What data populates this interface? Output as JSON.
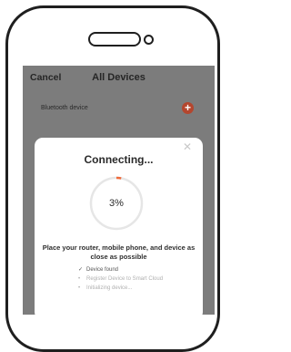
{
  "nav": {
    "cancel_label": "Cancel",
    "title": "All Devices"
  },
  "device": {
    "label": "Bluetooth device",
    "add_icon": "plus-circle-icon"
  },
  "dialog": {
    "close_icon": "close-icon",
    "title": "Connecting...",
    "progress_percent": 3,
    "progress_text": "3%",
    "instruction": "Place your router, mobile phone, and device as close as possible",
    "steps": [
      {
        "label": "Device found",
        "status": "done",
        "icon": "check-icon"
      },
      {
        "label": "Register Device to Smart Cloud",
        "status": "pending",
        "icon": "dot-icon"
      },
      {
        "label": "Initializing device...",
        "status": "pending",
        "icon": "dot-icon"
      }
    ]
  },
  "colors": {
    "overlay": "#7c7c7c",
    "accent": "#b4462e",
    "progress": "#ef6b3c",
    "track": "#e6e6e6"
  }
}
